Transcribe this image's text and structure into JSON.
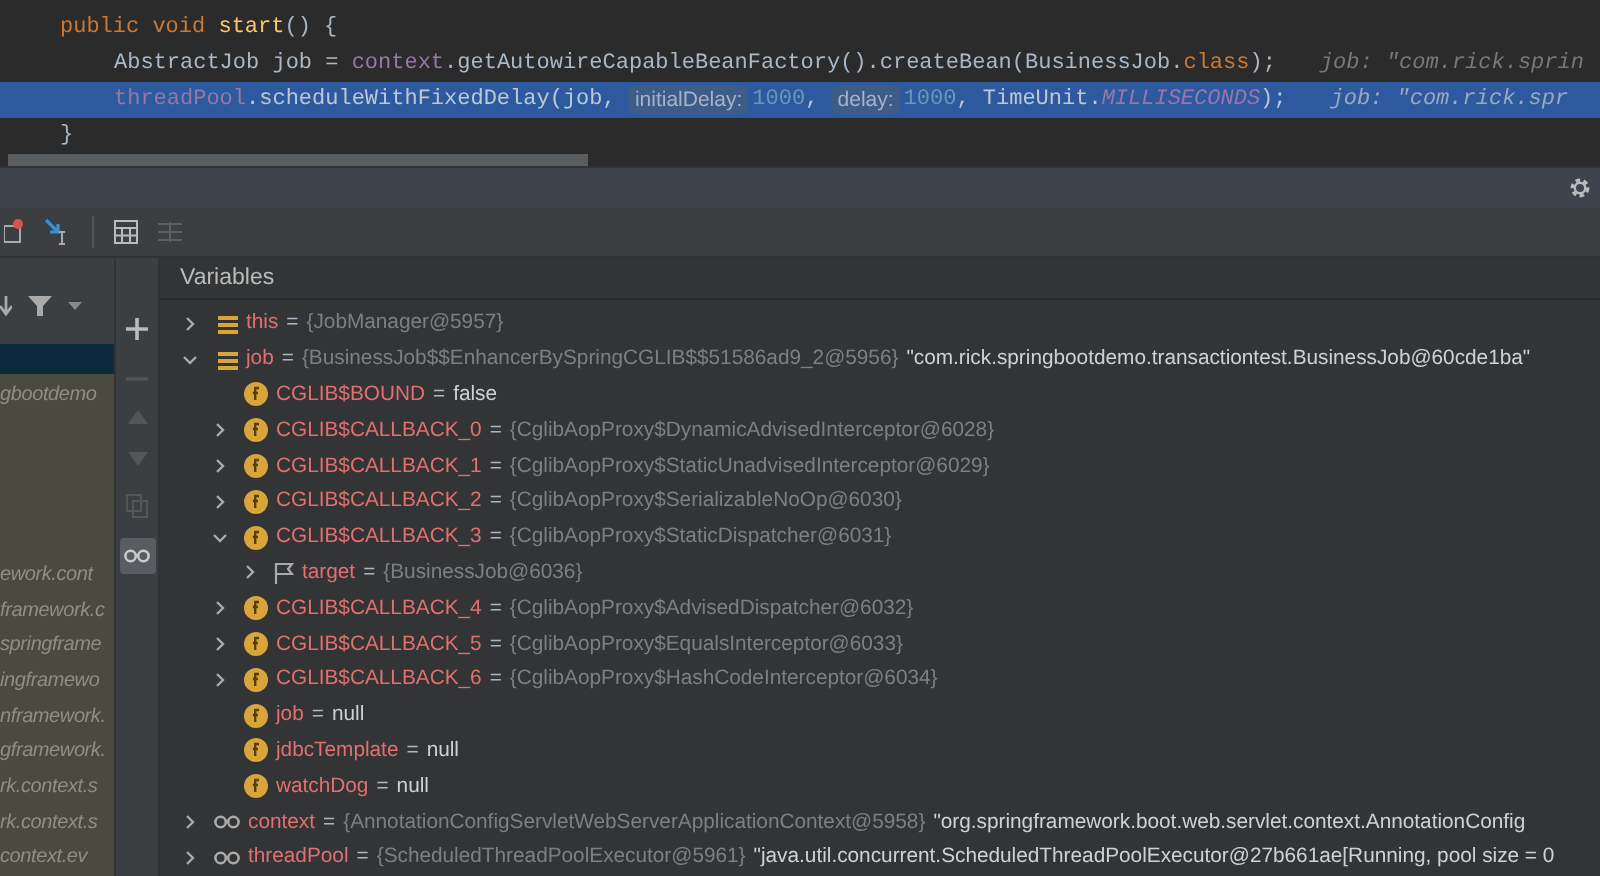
{
  "editor": {
    "lines": [
      {
        "selected": false,
        "kind": "outer",
        "tokens": [
          {
            "kind": "keyword",
            "text": "public void "
          },
          {
            "kind": "method",
            "text": "start"
          },
          {
            "kind": "plain",
            "text": "() {"
          }
        ]
      },
      {
        "selected": false,
        "kind": "body",
        "tokens": [
          {
            "kind": "plain",
            "text": "AbstractJob job = "
          },
          {
            "kind": "field",
            "text": "context"
          },
          {
            "kind": "plain",
            "text": ".getAutowireCapableBeanFactory().createBean(BusinessJob."
          },
          {
            "kind": "keyword",
            "text": "class"
          },
          {
            "kind": "plain",
            "text": ");"
          },
          {
            "kind": "inline-value",
            "text": "job: \"com.rick.sprin"
          }
        ]
      },
      {
        "selected": true,
        "kind": "body",
        "tokens": [
          {
            "kind": "field",
            "text": "threadPool"
          },
          {
            "kind": "plain",
            "text": ".scheduleWithFixedDelay(job, "
          },
          {
            "kind": "hint",
            "text": "initialDelay:"
          },
          {
            "kind": "number",
            "text": "1000"
          },
          {
            "kind": "plain",
            "text": ", "
          },
          {
            "kind": "hint",
            "text": "delay:"
          },
          {
            "kind": "number",
            "text": "1000"
          },
          {
            "kind": "plain",
            "text": ", TimeUnit."
          },
          {
            "kind": "constant",
            "text": "MILLISECONDS"
          },
          {
            "kind": "plain",
            "text": ");"
          },
          {
            "kind": "inline-value",
            "text": "job: \"com.rick.spr"
          }
        ]
      },
      {
        "selected": false,
        "kind": "outer",
        "tokens": [
          {
            "kind": "plain",
            "text": "}"
          }
        ]
      }
    ]
  },
  "frames": {
    "top": [
      "gbootdemo"
    ],
    "bottom": [
      "ework.cont",
      "framework.c",
      "springframe",
      "ingframewo",
      "nframework.",
      "gframework.",
      "rk.context.s",
      "rk.context.s",
      "context.ev"
    ]
  },
  "variables": {
    "title": "Variables",
    "tree": [
      {
        "kind": "object",
        "name": "this",
        "eq": "=",
        "value": "{JobManager@5957}",
        "expanded": false
      },
      {
        "kind": "object",
        "name": "job",
        "eq": "=",
        "value": "{BusinessJob$$EnhancerBySpringCGLIB$$51586ad9_2@5956}",
        "string": "\"com.rick.springbootdemo.transactiontest.BusinessJob@60cde1ba\"",
        "expanded": true,
        "children": [
          {
            "kind": "field",
            "name": "CGLIB$BOUND",
            "eq": "=",
            "literal": "false"
          },
          {
            "kind": "field",
            "name": "CGLIB$CALLBACK_0",
            "eq": "=",
            "value": "{CglibAopProxy$DynamicAdvisedInterceptor@6028}",
            "expanded": false
          },
          {
            "kind": "field",
            "name": "CGLIB$CALLBACK_1",
            "eq": "=",
            "value": "{CglibAopProxy$StaticUnadvisedInterceptor@6029}",
            "expanded": false
          },
          {
            "kind": "field",
            "name": "CGLIB$CALLBACK_2",
            "eq": "=",
            "value": "{CglibAopProxy$SerializableNoOp@6030}",
            "expanded": false
          },
          {
            "kind": "field",
            "name": "CGLIB$CALLBACK_3",
            "eq": "=",
            "value": "{CglibAopProxy$StaticDispatcher@6031}",
            "expanded": true,
            "children": [
              {
                "kind": "flag",
                "name": "target",
                "eq": "=",
                "value": "{BusinessJob@6036}",
                "expanded": false
              }
            ]
          },
          {
            "kind": "field",
            "name": "CGLIB$CALLBACK_4",
            "eq": "=",
            "value": "{CglibAopProxy$AdvisedDispatcher@6032}",
            "expanded": false
          },
          {
            "kind": "field",
            "name": "CGLIB$CALLBACK_5",
            "eq": "=",
            "value": "{CglibAopProxy$EqualsInterceptor@6033}",
            "expanded": false
          },
          {
            "kind": "field",
            "name": "CGLIB$CALLBACK_6",
            "eq": "=",
            "value": "{CglibAopProxy$HashCodeInterceptor@6034}",
            "expanded": false
          },
          {
            "kind": "field",
            "name": "job",
            "eq": "=",
            "literal": "null"
          },
          {
            "kind": "field",
            "name": "jdbcTemplate",
            "eq": "=",
            "literal": "null"
          },
          {
            "kind": "field",
            "name": "watchDog",
            "eq": "=",
            "literal": "null"
          }
        ]
      },
      {
        "kind": "watch",
        "name": "context",
        "eq": "=",
        "value": "{AnnotationConfigServletWebServerApplicationContext@5958}",
        "string": "\"org.springframework.boot.web.servlet.context.AnnotationConfig",
        "expanded": false
      },
      {
        "kind": "watch",
        "name": "threadPool",
        "eq": "=",
        "value": "{ScheduledThreadPoolExecutor@5961}",
        "string": "\"java.util.concurrent.ScheduledThreadPoolExecutor@27b661ae[Running, pool size = 0",
        "expanded": false
      }
    ]
  }
}
